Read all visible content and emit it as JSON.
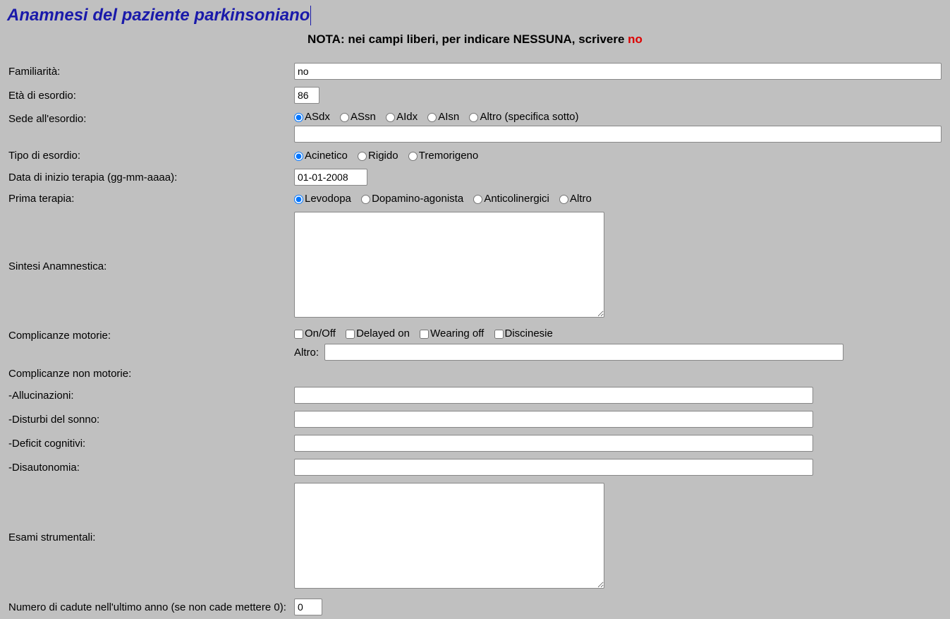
{
  "title": "Anamnesi del paziente parkinsoniano",
  "note_prefix": "NOTA: nei campi liberi, per indicare NESSUNA, scrivere ",
  "note_no": "no",
  "fields": {
    "familiarita": {
      "label": "Familiarità:",
      "value": "no"
    },
    "eta_esordio": {
      "label": "Età di esordio:",
      "value": "86"
    },
    "sede_esordio": {
      "label": "Sede all'esordio:",
      "options": [
        "ASdx",
        "ASsn",
        "AIdx",
        "AIsn",
        "Altro (specifica sotto)"
      ],
      "selected": "ASdx",
      "altro_value": ""
    },
    "tipo_esordio": {
      "label": "Tipo di esordio:",
      "options": [
        "Acinetico",
        "Rigido",
        "Tremorigeno"
      ],
      "selected": "Acinetico"
    },
    "data_inizio": {
      "label": "Data di inizio terapia (gg-mm-aaaa):",
      "value": "01-01-2008"
    },
    "prima_terapia": {
      "label": "Prima terapia:",
      "options": [
        "Levodopa",
        "Dopamino-agonista",
        "Anticolinergici",
        "Altro"
      ],
      "selected": "Levodopa"
    },
    "sintesi": {
      "label": "Sintesi Anamnestica:",
      "value": ""
    },
    "compl_motorie": {
      "label": "Complicanze motorie:",
      "options": [
        "On/Off",
        "Delayed on",
        "Wearing off",
        "Discinesie"
      ],
      "altro_label": "Altro:",
      "altro_value": ""
    },
    "compl_non_motorie": {
      "label": "Complicanze non motorie:",
      "allucinazioni": {
        "label": "-Allucinazioni:",
        "value": ""
      },
      "disturbi_sonno": {
        "label": "-Disturbi del sonno:",
        "value": ""
      },
      "deficit_cognitivi": {
        "label": "-Deficit cognitivi:",
        "value": ""
      },
      "disautonomia": {
        "label": "-Disautonomia:",
        "value": ""
      }
    },
    "esami": {
      "label": "Esami strumentali:",
      "value": ""
    },
    "cadute": {
      "label": "Numero di cadute nell'ultimo anno (se non cade mettere 0):",
      "value": "0"
    }
  }
}
